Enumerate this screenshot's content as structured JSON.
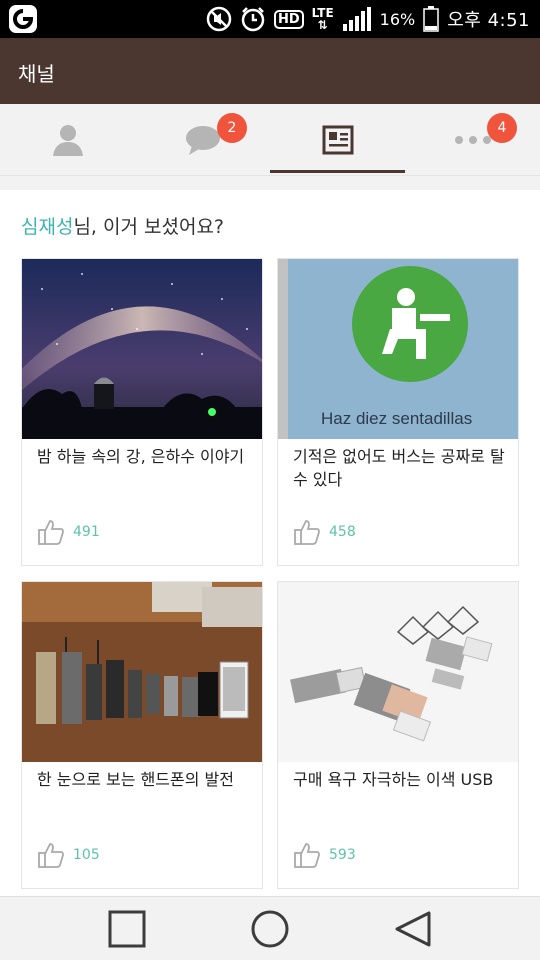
{
  "status_bar": {
    "battery": "16%",
    "time": "오후 4:51",
    "lte": "LTE",
    "hd": "HD",
    "icons": [
      "app-logo-icon",
      "mute-icon",
      "alarm-icon",
      "hd-icon",
      "lte-icon",
      "signal-icon",
      "battery-icon"
    ]
  },
  "appbar": {
    "title": "채널"
  },
  "tabs": [
    {
      "icon": "profile-icon",
      "badge": ""
    },
    {
      "icon": "chat-icon",
      "badge": "2"
    },
    {
      "icon": "channel-icon",
      "badge": "",
      "active": true
    },
    {
      "icon": "more-icon",
      "badge": "4"
    }
  ],
  "greeting": {
    "user": "심재성",
    "text": "님, 이거 보셨어요?"
  },
  "cards": [
    {
      "title": "밤 하늘 속의 강, 은하수 이야기",
      "likes": "491",
      "image": "milky-way"
    },
    {
      "title": "기적은 없어도 버스는 공짜로 탈 수 있다",
      "likes": "458",
      "image": "squat-sign",
      "image_text": "Haz diez sentadillas"
    },
    {
      "title": "한 눈으로 보는 핸드폰의 발전",
      "likes": "105",
      "image": "phones-evolution"
    },
    {
      "title": "구매 욕구 자극하는 이색 USB",
      "likes": "593",
      "image": "crystal-usb"
    }
  ],
  "colors": {
    "appbar": "#4b3630",
    "accent": "#3bb5b0",
    "badge": "#f0543c",
    "likes": "#5cc3a9"
  },
  "navbar": [
    "recent-apps-icon",
    "home-icon",
    "back-icon"
  ]
}
